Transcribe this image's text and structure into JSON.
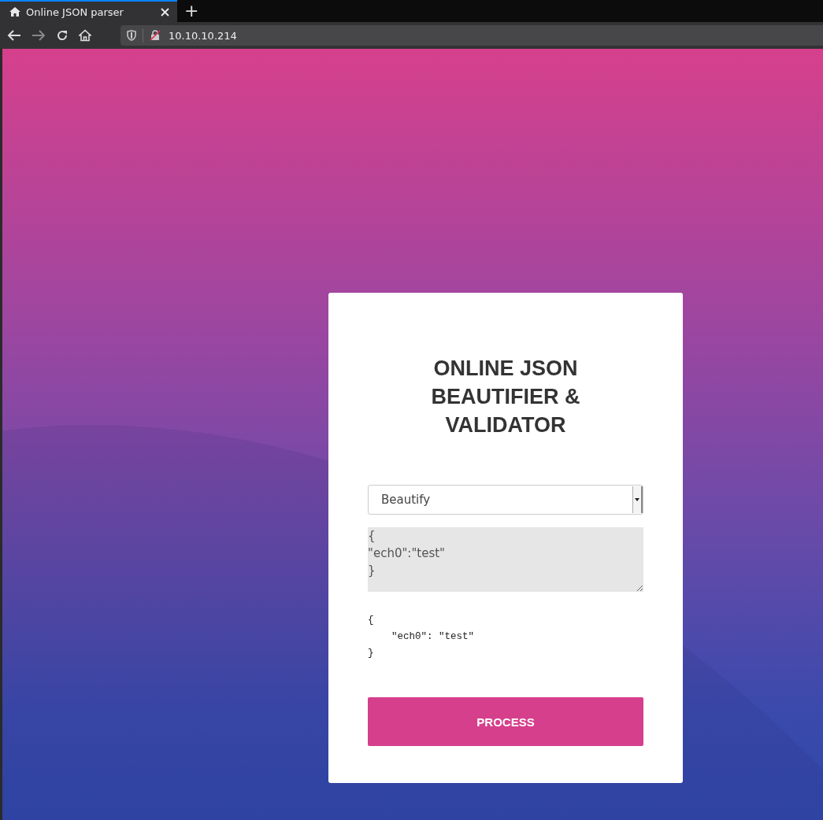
{
  "browser": {
    "tab_title": "Online JSON parser",
    "new_tab": "+",
    "url": "10.10.10.214"
  },
  "card": {
    "title": "ONLINE JSON BEAUTIFIER & VALIDATOR",
    "mode_select": {
      "value": "Beautify"
    },
    "input": {
      "value": "{\n\"ech0\":\"test\"\n}"
    },
    "output": "{\n    \"ech0\": \"test\"\n}",
    "button": "PROCESS"
  }
}
